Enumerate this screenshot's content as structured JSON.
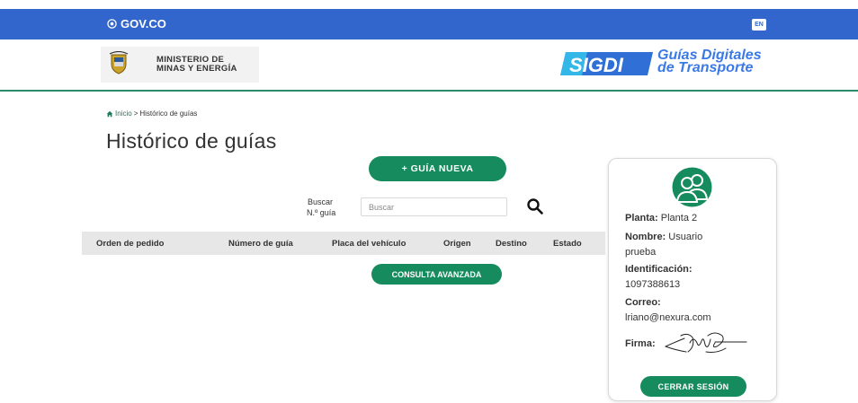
{
  "gov_bar": {
    "brand": "GOV.CO",
    "lang": "EN"
  },
  "header": {
    "ministry_line1": "MINISTERIO DE",
    "ministry_line2": "MINAS Y ENERGÍA",
    "sigdi_logo": "SIGDI",
    "sigdi_tag_line1": "Guías Digitales",
    "sigdi_tag_line2": "de Transporte"
  },
  "breadcrumb": {
    "home": "Inicio",
    "separator": ">",
    "current": "Histórico de guías"
  },
  "page_title": "Histórico de guías",
  "new_button": "+ GUÍA NUEVA",
  "search": {
    "label_line1": "Buscar",
    "label_line2": "N.º guía",
    "placeholder": "Buscar",
    "value": ""
  },
  "table": {
    "columns": [
      "Orden de pedido",
      "Número de guía",
      "Placa del vehículo",
      "Origen",
      "Destino",
      "Estado"
    ]
  },
  "advanced_button": "CONSULTA AVANZADA",
  "user_card": {
    "planta_label": "Planta:",
    "planta_value": "Planta 2",
    "nombre_label": "Nombre:",
    "nombre_value_line1": "Usuario",
    "nombre_value_line2": "prueba",
    "id_label": "Identificación:",
    "id_value": "1097388613",
    "correo_label": "Correo:",
    "correo_value": "lriano@nexura.com",
    "firma_label": "Firma:",
    "logout_button": "CERRAR SESIÓN"
  },
  "colors": {
    "gov_blue": "#3366cc",
    "primary_green": "#168b5d",
    "rule_green": "#2a8c6b",
    "sigdi_blue": "#3a79e6"
  },
  "icons": [
    "gov-co-icon",
    "colombia-shield-icon",
    "home-icon",
    "search-icon",
    "user-group-avatar-icon",
    "signature-image"
  ]
}
